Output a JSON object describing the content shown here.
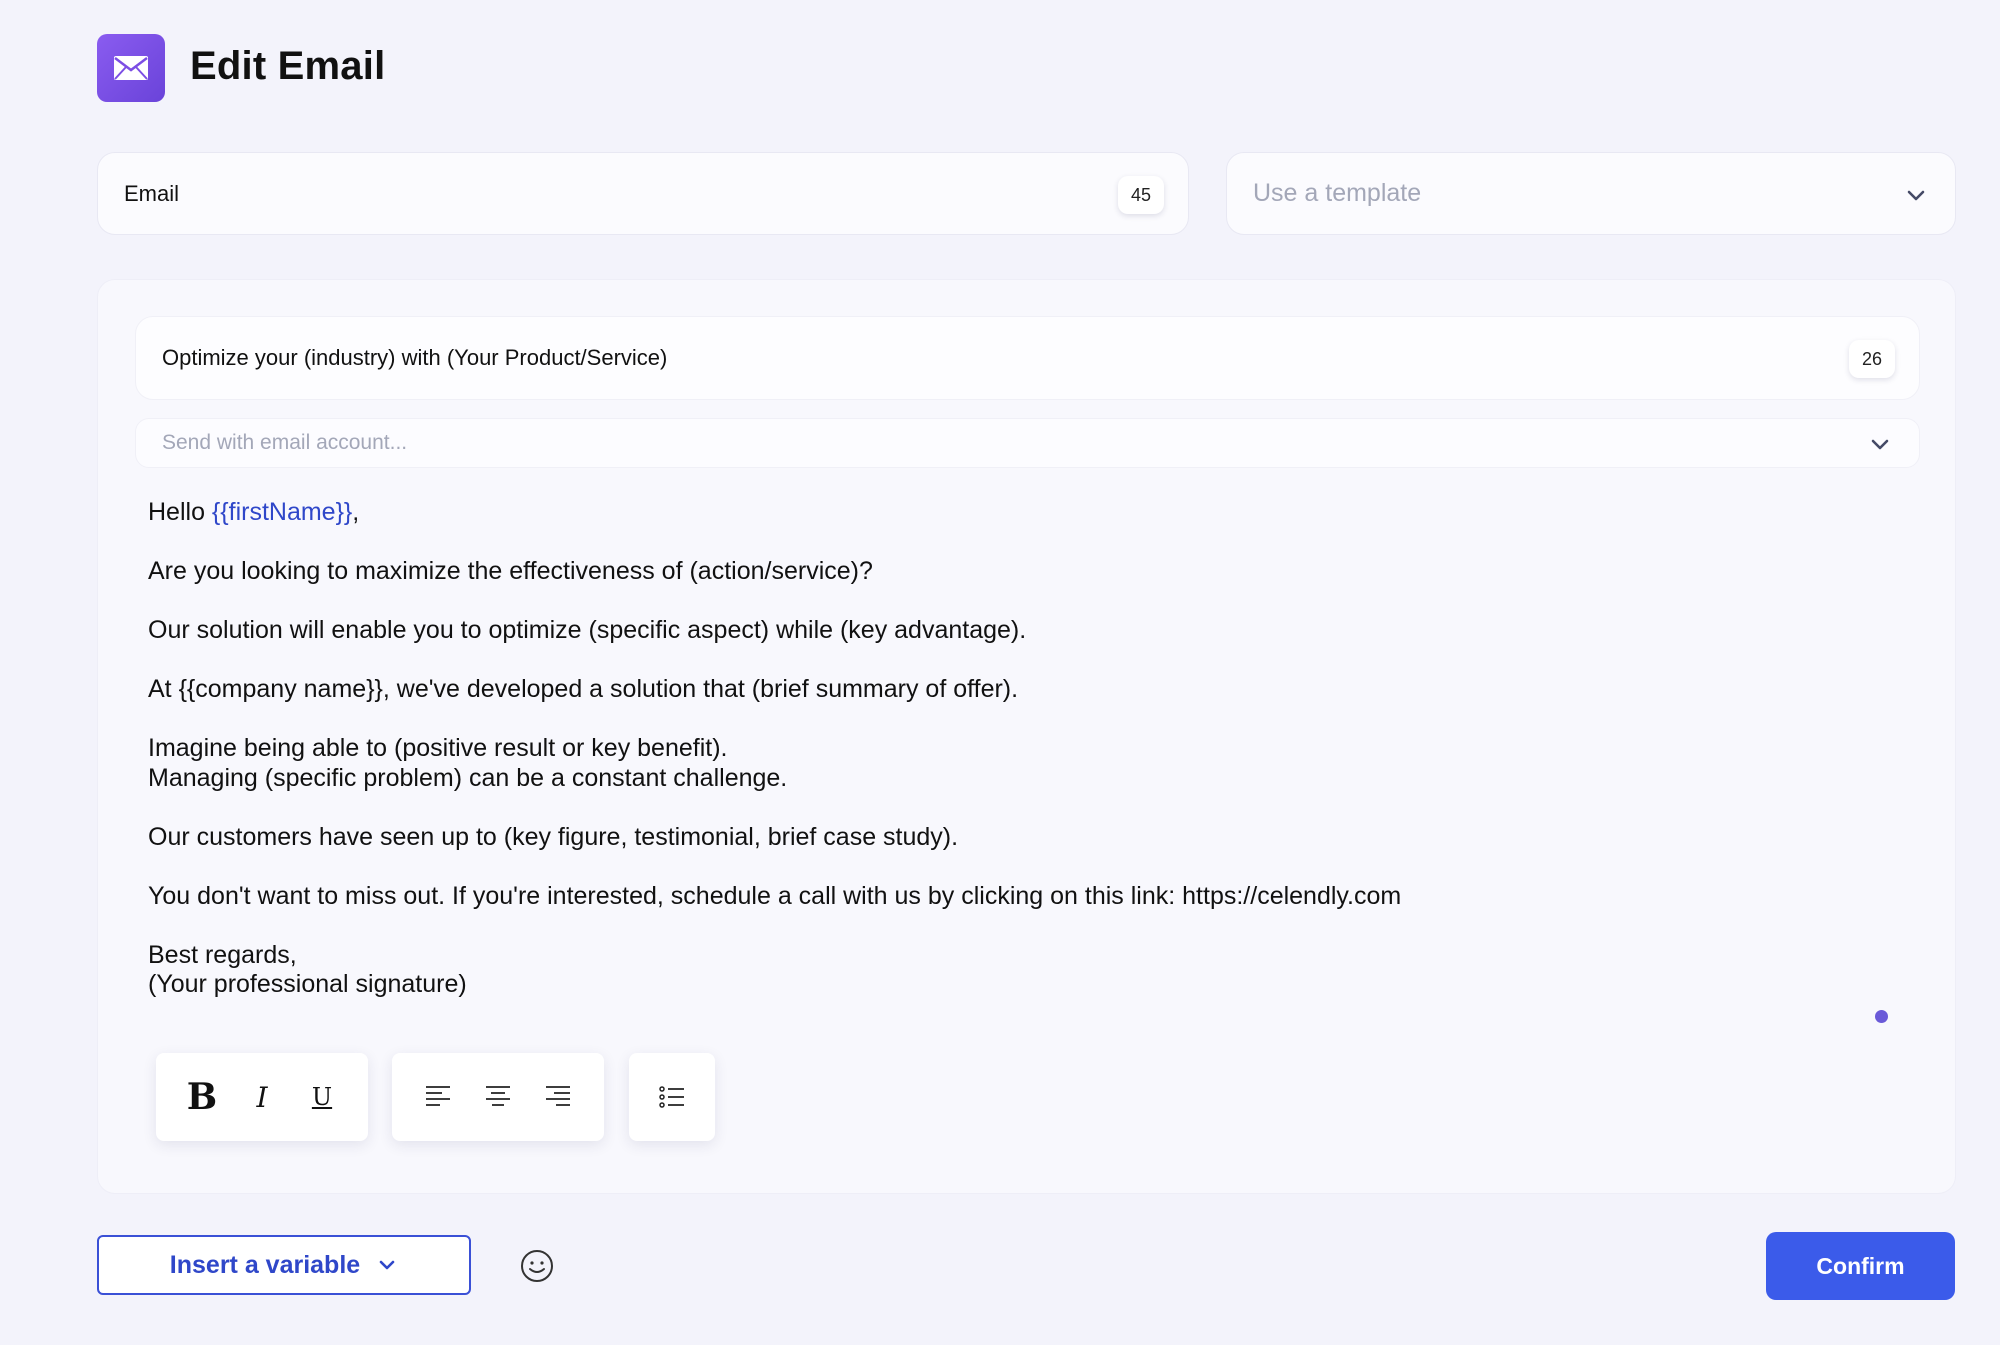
{
  "header": {
    "title": "Edit Email",
    "icon": "envelope-icon",
    "accent": "#7c4ee4"
  },
  "email_field": {
    "label": "Email",
    "count": "45"
  },
  "template_select": {
    "placeholder": "Use a template"
  },
  "editor": {
    "subject": {
      "value": "Optimize your (industry) with (Your Product/Service)",
      "count": "26"
    },
    "account_select": {
      "placeholder": "Send with email account..."
    },
    "body": {
      "greeting_prefix": "Hello ",
      "greeting_variable": "{{firstName}}",
      "greeting_suffix": ",",
      "line_1": "Are you looking to maximize the effectiveness of (action/service)?",
      "line_2": "Our solution will enable you to optimize (specific aspect) while (key advantage).",
      "line_3": "At {{company name}}, we've developed a solution that (brief summary of offer).",
      "line_4a": "Imagine being able to (positive result or key benefit).",
      "line_4b": "Managing (specific problem) can be a constant challenge.",
      "line_5": "Our customers have seen up to (key figure, testimonial, brief case study).",
      "line_6": "You don't want to miss out. If you're interested, schedule a call with us by clicking on this link: https://celendly.com",
      "signoff_1": "Best regards,",
      "signoff_2": "(Your professional signature)"
    },
    "toolbar": {
      "bold": "B",
      "italic": "I",
      "underline": "U",
      "icons": [
        "align-left-icon",
        "align-center-icon",
        "align-right-icon",
        "bullet-list-icon"
      ]
    }
  },
  "footer": {
    "insert_variable_label": "Insert a variable",
    "confirm_label": "Confirm",
    "primary_color": "#3b5bea"
  }
}
